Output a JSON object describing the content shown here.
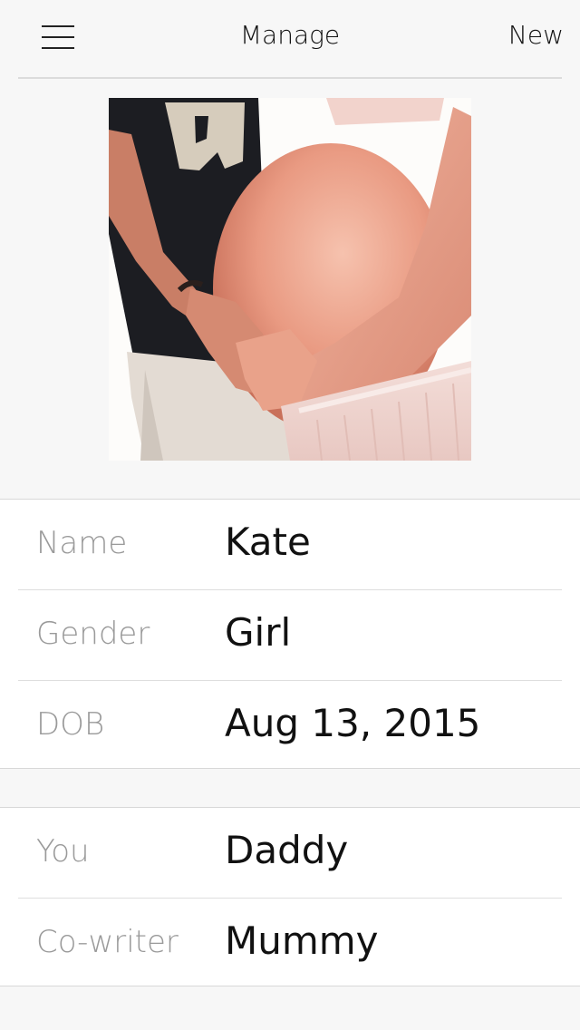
{
  "header": {
    "title": "Manage",
    "new_label": "New"
  },
  "profile_form": {
    "rows": [
      {
        "label": "Name",
        "value": "Kate"
      },
      {
        "label": "Gender",
        "value": "Girl"
      },
      {
        "label": "DOB",
        "value": "Aug 13, 2015"
      }
    ]
  },
  "relation_form": {
    "rows": [
      {
        "label": "You",
        "value": "Daddy"
      },
      {
        "label": "Co-writer",
        "value": "Mummy"
      }
    ]
  },
  "icons": {
    "menu": "hamburger-menu-icon"
  }
}
